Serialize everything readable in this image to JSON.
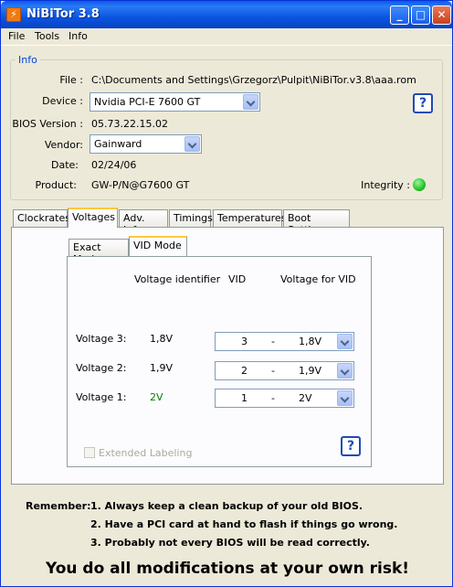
{
  "window": {
    "title": "NiBiTor 3.8"
  },
  "menu": [
    "File",
    "Tools",
    "Info"
  ],
  "info": {
    "group_label": "Info",
    "file_label": "File :",
    "file_value": "C:\\Documents and Settings\\Grzegorz\\Pulpit\\NiBiTor.v3.8\\aaa.rom",
    "device_label": "Device :",
    "device_value": "Nvidia PCI-E 7600 GT",
    "bios_label": "BIOS Version :",
    "bios_value": "05.73.22.15.02",
    "vendor_label": "Vendor:",
    "vendor_value": "Gainward",
    "date_label": "Date:",
    "date_value": "02/24/06",
    "product_label": "Product:",
    "product_value": "GW-P/N@G7600 GT",
    "integrity_label": "Integrity :",
    "help_label": "?"
  },
  "tabs": [
    "Clockrates",
    "Voltages",
    "Adv. Info",
    "Timings",
    "Temperatures",
    "Boot Settings"
  ],
  "subtabs": [
    "Exact Mode",
    "VID Mode"
  ],
  "voltages": {
    "col_identifier": "Voltage identifier",
    "col_vid": "VID",
    "col_voltage": "Voltage for VID",
    "rows": [
      {
        "label": "Voltage 3:",
        "identifier": "1,8V",
        "vid": "3",
        "sep": "-",
        "voltage": "1,8V"
      },
      {
        "label": "Voltage 2:",
        "identifier": "1,9V",
        "vid": "2",
        "sep": "-",
        "voltage": "1,9V"
      },
      {
        "label": "Voltage 1:",
        "identifier": "2V",
        "vid": "1",
        "sep": "-",
        "voltage": "2V"
      }
    ],
    "extended_labeling": "Extended Labeling",
    "help_label": "?"
  },
  "remember": {
    "label": "Remember:",
    "notes": [
      "1. Always keep a clean backup of your old BIOS.",
      "2. Have a PCI card at hand to flash if things go wrong.",
      "3. Probably not every BIOS will be read correctly."
    ]
  },
  "warning": "You do all modifications at your own risk!",
  "colors": {
    "accent": "#0046d5",
    "identifier_highlight": "#008000",
    "integrity": "#22c322"
  }
}
